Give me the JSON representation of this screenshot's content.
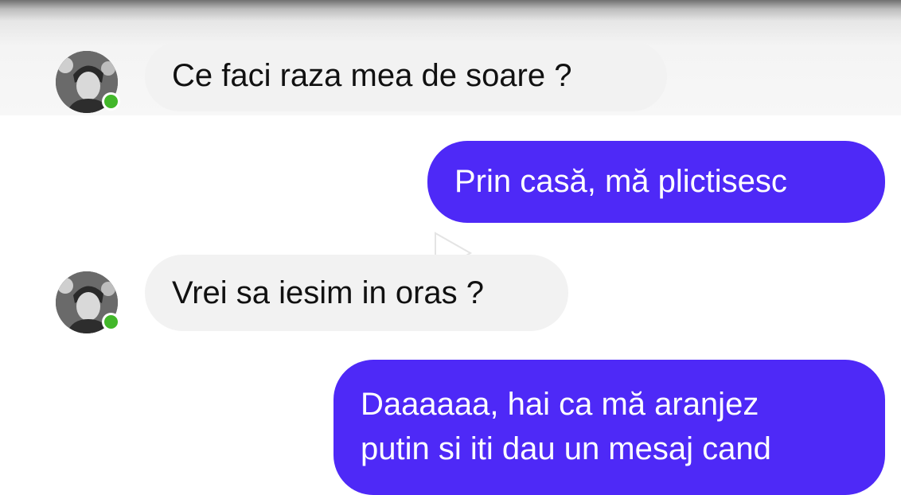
{
  "messages": [
    {
      "id": "m1",
      "direction": "incoming",
      "text": "Ce faci raza mea de soare ?",
      "sender_online": true
    },
    {
      "id": "m2",
      "direction": "outgoing",
      "text": "Prin casă, mă plictisesc"
    },
    {
      "id": "m3",
      "direction": "incoming",
      "text": "Vrei sa iesim in oras ?",
      "sender_online": true
    },
    {
      "id": "m4",
      "direction": "outgoing",
      "lines": [
        "Daaaaaa, hai ca mă aranjez",
        "putin si iti dau un mesaj cand"
      ]
    }
  ],
  "overlay": {
    "icon": "play-icon"
  },
  "colors": {
    "outgoing_bubble": "#4e29f7",
    "incoming_bubble": "#f2f2f2",
    "online_indicator": "#42b72a"
  }
}
